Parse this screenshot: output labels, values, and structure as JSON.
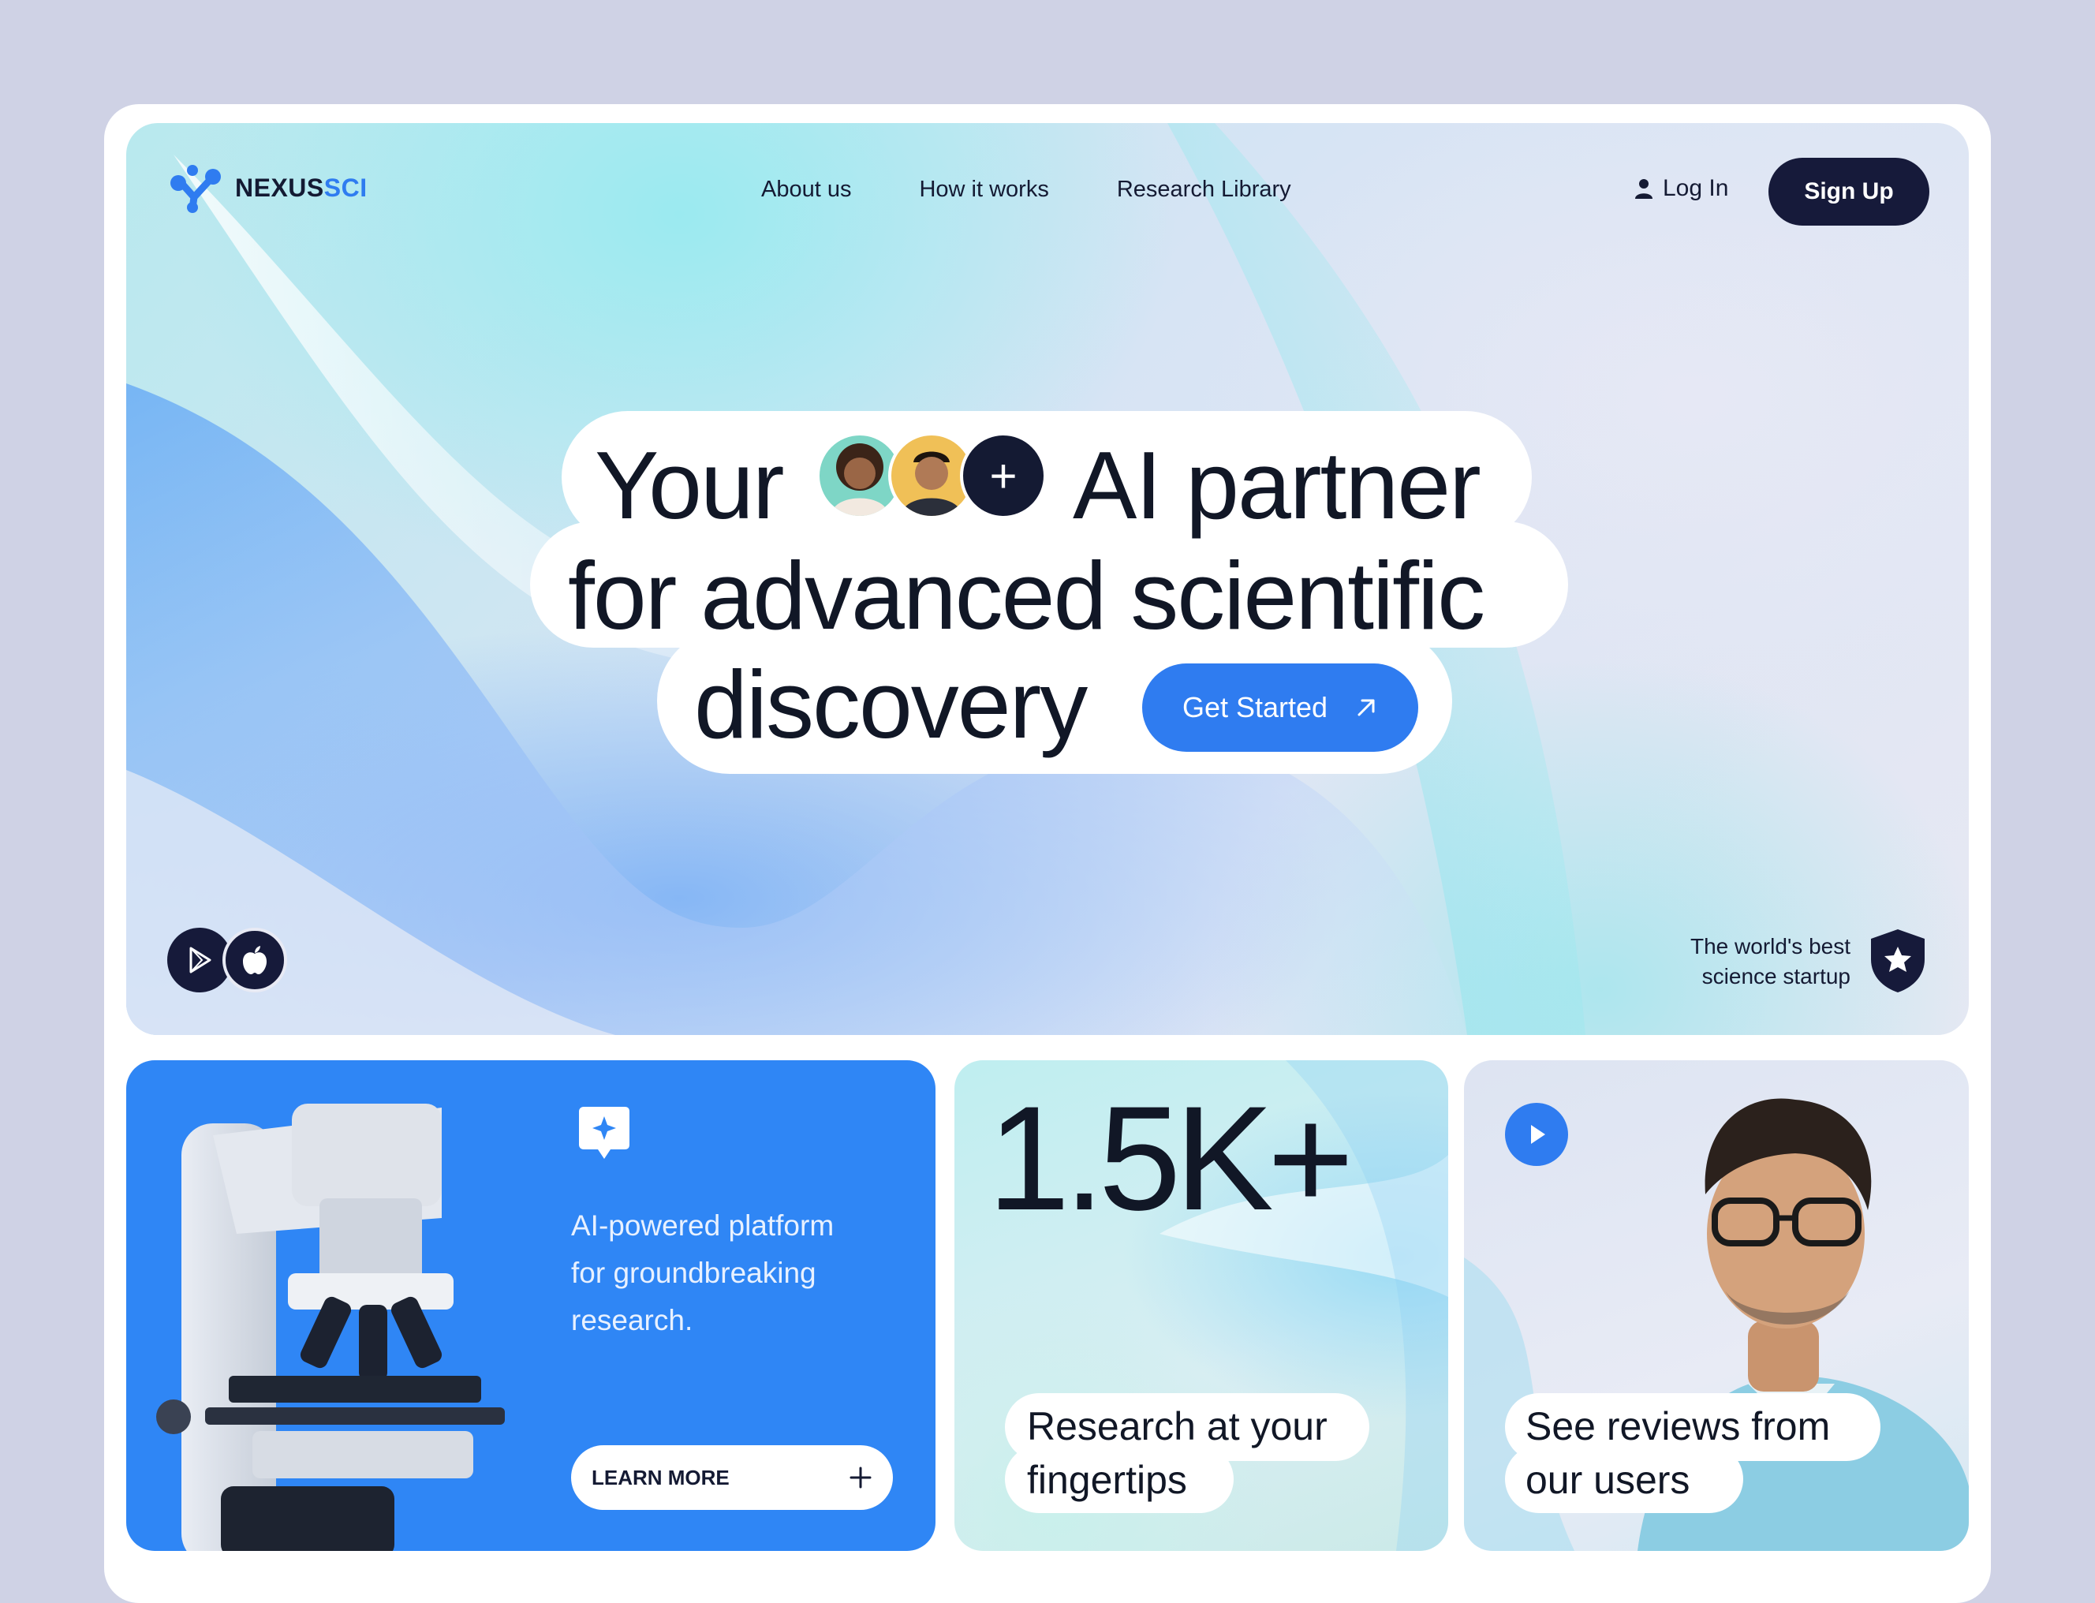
{
  "brand": {
    "name_primary": "NEXUS",
    "name_accent": "SCI",
    "logo_icon": "molecule-icon"
  },
  "nav": {
    "links": [
      "About us",
      "How it works",
      "Research Library"
    ],
    "login_label": "Log In",
    "signup_label": "Sign Up"
  },
  "hero": {
    "headline_line1_start": "Your",
    "headline_line1_end": "AI partner",
    "headline_line2": "for advanced scientific",
    "headline_line3": "discovery",
    "avatar_plus": "+",
    "cta_label": "Get Started",
    "badge_line1": "The world's best",
    "badge_line2": "science startup",
    "store_icons": [
      "google-play-icon",
      "apple-icon"
    ]
  },
  "cards": {
    "platform": {
      "text_line1": "AI-powered platform",
      "text_line2": "for groundbreaking",
      "text_line3": "research.",
      "button_label": "LEARN MORE",
      "button_icon": "plus-icon"
    },
    "stats": {
      "value": "1.5K+",
      "caption_line1": "Research at your",
      "caption_line2": "fingertips"
    },
    "reviews": {
      "caption_line1": "See reviews from",
      "caption_line2": "our users",
      "play_icon": "play-icon"
    }
  },
  "colors": {
    "accent": "#2f7cf0",
    "dark": "#161a3a",
    "page_bg": "#cfd2e5"
  }
}
